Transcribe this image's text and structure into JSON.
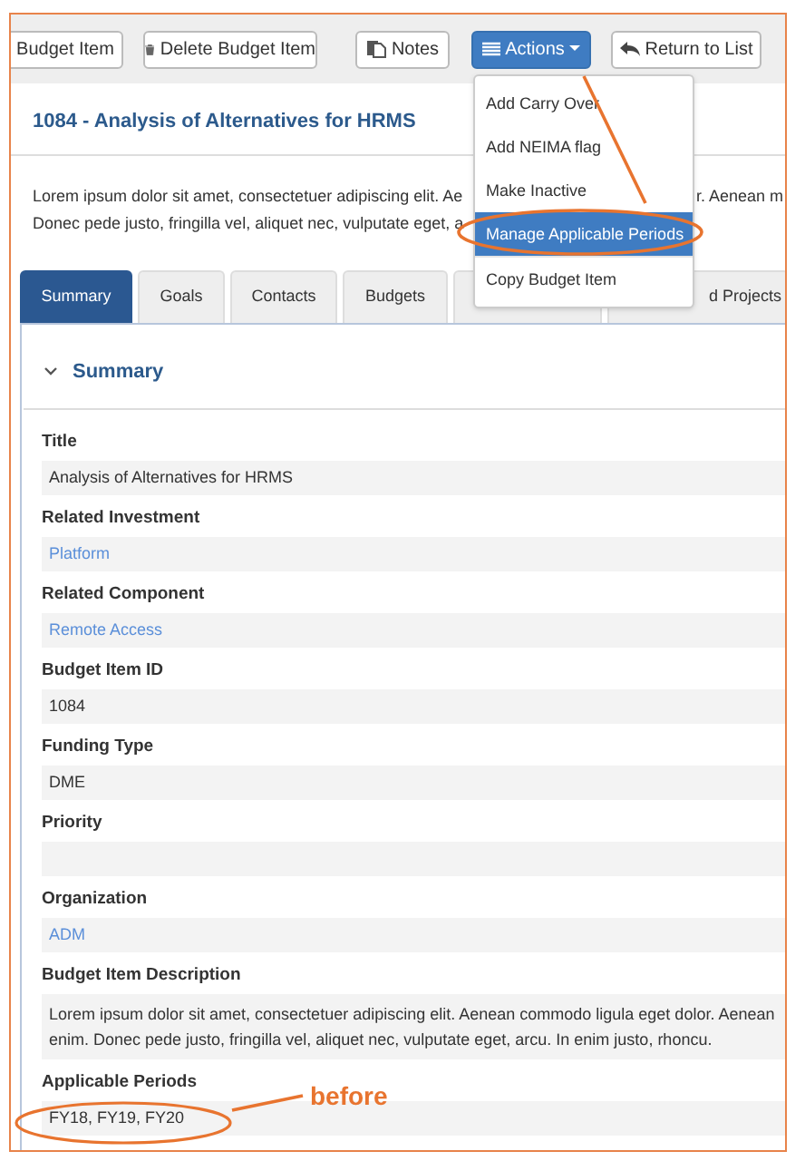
{
  "toolbar": {
    "buttons": [
      {
        "label": "Budget Item",
        "kind": "edit"
      },
      {
        "label": "Delete Budget Item",
        "kind": "delete"
      },
      {
        "label": "Notes",
        "kind": "notes"
      },
      {
        "label": "Actions",
        "kind": "actions",
        "expanded": true
      },
      {
        "label": "Return to List",
        "kind": "return"
      }
    ]
  },
  "actions_menu": {
    "items": [
      {
        "label": "Add Carry Over",
        "selected": false
      },
      {
        "label": "Add NEIMA flag",
        "selected": false
      },
      {
        "label": "Make Inactive",
        "selected": false
      },
      {
        "label": "Manage Applicable Periods",
        "selected": true
      },
      {
        "label": "Copy Budget Item",
        "selected": false
      }
    ]
  },
  "title": "1084 - Analysis of Alternatives for HRMS",
  "intro": {
    "line_1_left": "Lorem ipsum dolor sit amet, consectetuer adipiscing elit. Ae",
    "line_1_right": "r. Aenean m",
    "line_2_left": "Donec pede justo, fringilla vel, aliquet nec, vulputate eget, a"
  },
  "tabs": [
    {
      "label": "Summary",
      "selected": true
    },
    {
      "label": "Goals",
      "selected": false
    },
    {
      "label": "Contacts",
      "selected": false
    },
    {
      "label": "Budgets",
      "selected": false
    },
    {
      "selected": false
    },
    {
      "label": "d Projects",
      "selected": false
    }
  ],
  "section": {
    "title": "Summary",
    "expanded": true,
    "fields": [
      {
        "label": "Title",
        "kind": "text",
        "value": "Analysis of Alternatives for HRMS"
      },
      {
        "label": "Related Investment",
        "kind": "link",
        "value": "Platform"
      },
      {
        "label": "Related Component",
        "kind": "link",
        "value": "Remote Access"
      },
      {
        "label": "Budget Item ID",
        "kind": "text",
        "value": "1084"
      },
      {
        "label": "Funding Type",
        "kind": "text",
        "value": "DME"
      },
      {
        "label": "Priority",
        "kind": "text"
      },
      {
        "label": "Organization",
        "kind": "link",
        "value": "ADM"
      },
      {
        "label": "Budget Item Description",
        "kind": "multiline",
        "lines": [
          "Lorem ipsum dolor sit amet, consectetuer adipiscing elit. Aenean commodo ligula eget dolor. Aenean",
          "enim. Donec pede justo, fringilla vel, aliquet nec, vulputate eget, arcu. In enim justo, rhoncu."
        ]
      },
      {
        "label": "Applicable Periods",
        "kind": "text",
        "value": "FY18, FY19, FY20"
      }
    ]
  },
  "annotation": {
    "label": "before"
  }
}
